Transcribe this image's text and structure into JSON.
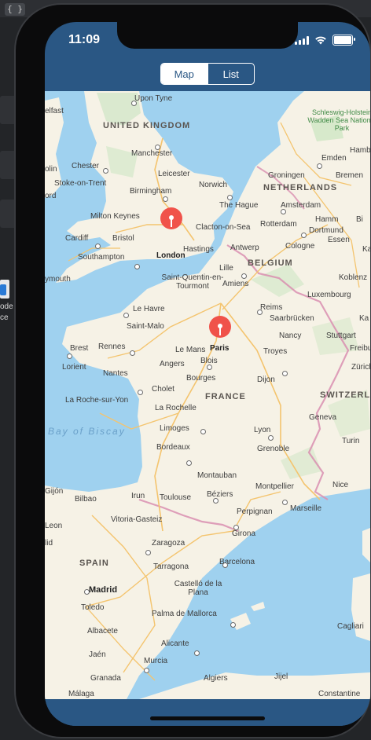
{
  "desktop": {
    "brace_icon": "{ }",
    "file_label": "ode\nce"
  },
  "status_bar": {
    "time": "11:09",
    "icons": [
      "cellular-signal-icon",
      "wifi-icon",
      "battery-icon"
    ]
  },
  "segmented_control": {
    "options": [
      {
        "label": "Map",
        "selected": true
      },
      {
        "label": "List",
        "selected": false
      }
    ]
  },
  "map": {
    "countries": [
      "UNITED KINGDOM",
      "NETHERLANDS",
      "BELGIUM",
      "FRANCE",
      "SWITZERLAND",
      "SPAIN"
    ],
    "seas": [
      "Bay of Biscay"
    ],
    "parks": [
      "Schleswig-Holstein Wadden Sea National Park"
    ],
    "cities": [
      "elfast",
      "Upon Tyne",
      "Manchester",
      "Chester",
      "olin",
      "Leicester",
      "Stoke-on-Trent",
      "Birmingham",
      "Norwich",
      "ord",
      "Milton Keynes",
      "Clacton-on-Sea",
      "Cardiff",
      "Bristol",
      "Southampton",
      "Hastings",
      "ymouth",
      "Emden",
      "Hambu",
      "Groningen",
      "Bremen",
      "Amsterdam",
      "The Hague",
      "Hamm",
      "Bi",
      "Rotterdam",
      "Essen",
      "Antwerp",
      "Dortmund",
      "Lille",
      "Cologne",
      "Kassel",
      "Saint-Quentin-en-Tourmont",
      "Amiens",
      "Koblenz",
      "Le Havre",
      "Luxembourg",
      "Reims",
      "Saint-Malo",
      "Saarbrücken",
      "Nancy",
      "Stuttgart",
      "Brest",
      "Rennes",
      "Le Mans",
      "Troyes",
      "Freibu",
      "Lorient",
      "Angers",
      "Blois",
      "Zürich",
      "Nantes",
      "Cholet",
      "Bourges",
      "Dijon",
      "La Roche-sur-Yon",
      "La Rochelle",
      "Geneva",
      "Limoges",
      "Lyon",
      "Bordeaux",
      "Grenoble",
      "Turin",
      "Montauban",
      "Gijón",
      "Bilbao",
      "Irun",
      "Toulouse",
      "Béziers",
      "Montpellier",
      "Nice",
      "Marseille",
      "Vitoria-Gasteiz",
      "Perpignan",
      "Leon",
      "Girona",
      "lid",
      "Zaragoza",
      "Barcelona",
      "Tarragona",
      "Madrid",
      "Castelló de la Plana",
      "Toledo",
      "Palma de Mallorca",
      "Albacete",
      "Cagliari",
      "Alicante",
      "Jaén",
      "Murcia",
      "Granada",
      "Jijel",
      "Algiers",
      "Málaga",
      "Constantine",
      "Ka"
    ],
    "pins": [
      {
        "name": "London",
        "color": "#f0524a"
      },
      {
        "name": "Paris",
        "color": "#f0524a"
      }
    ],
    "colors": {
      "water": "#9fd1ef",
      "land": "#f6f2e6",
      "green": "#cfe6c4",
      "border": "#d98fb0",
      "highway": "#f4c46e",
      "pin": "#f0524a"
    }
  },
  "colors": {
    "nav_blue": "#2a5784"
  }
}
